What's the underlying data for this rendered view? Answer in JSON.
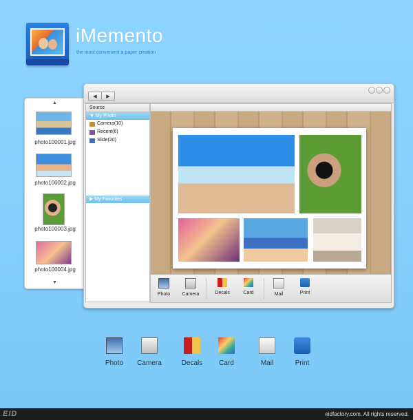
{
  "app": {
    "title": "iMemento",
    "tagline": "the most convenient a paper creation"
  },
  "colors": {
    "background": "#8ed4ff",
    "selection": "#7ec8f0",
    "title_text": "#ffffff"
  },
  "thumb_panel": {
    "up_arrow": "▲",
    "down_arrow": "▼",
    "items": [
      {
        "label": "photo100001.jpg"
      },
      {
        "label": "photo100002.jpg"
      },
      {
        "label": "photo100003.jpg"
      },
      {
        "label": "photo100004.jpg"
      }
    ]
  },
  "window": {
    "nav_back": "◀",
    "nav_forward": "▶",
    "sidebar": {
      "header": "Source",
      "group1": "▼ My Photo",
      "items": [
        {
          "label": "Camera(10)",
          "icon": "camera-icon"
        },
        {
          "label": "Recent(6)",
          "icon": "recent-icon"
        },
        {
          "label": "Slide(20)",
          "icon": "slide-icon"
        }
      ],
      "group2": "▶ My Favorites"
    },
    "toolbar": [
      {
        "label": "Photo",
        "icon": "photo-icon"
      },
      {
        "label": "Camera",
        "icon": "camera-icon"
      },
      {
        "label": "Decals",
        "icon": "decals-icon"
      },
      {
        "label": "Card",
        "icon": "card-icon"
      },
      {
        "label": "Mail",
        "icon": "mail-icon"
      },
      {
        "label": "Print",
        "icon": "print-icon"
      }
    ]
  },
  "bottom_toolbar": [
    {
      "label": "Photo",
      "icon": "photo-icon"
    },
    {
      "label": "Camera",
      "icon": "camera-icon"
    },
    {
      "label": "Decals",
      "icon": "decals-icon"
    },
    {
      "label": "Card",
      "icon": "card-icon"
    },
    {
      "label": "Mail",
      "icon": "mail-icon"
    },
    {
      "label": "Print",
      "icon": "print-icon"
    }
  ],
  "footer": {
    "logo": "EID",
    "text": "eidfactory.com. All rights reserved."
  }
}
